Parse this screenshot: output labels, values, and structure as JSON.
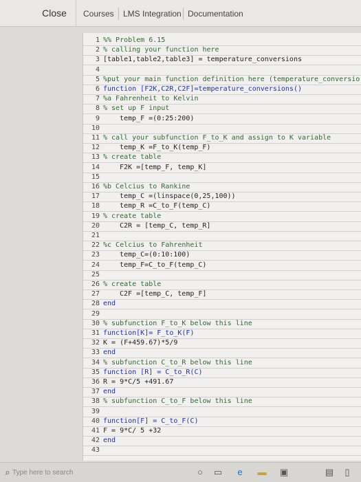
{
  "header": {
    "close_label": "Close",
    "tabs": [
      {
        "label": "Courses"
      },
      {
        "label": "LMS Integration"
      },
      {
        "label": "Documentation"
      }
    ]
  },
  "editor": {
    "lines": [
      {
        "num": "1",
        "text": "%% Problem 6.15",
        "type": "comment",
        "indent": 0
      },
      {
        "num": "2",
        "text": "% calling your function here",
        "type": "comment",
        "indent": 0
      },
      {
        "num": "3",
        "text": "[table1,table2,table3] = temperature_conversions",
        "type": "code",
        "indent": 0
      },
      {
        "num": "4",
        "text": "",
        "type": "code",
        "indent": 0
      },
      {
        "num": "5",
        "text": "%put your main function definition here (temperature_conversio",
        "type": "comment",
        "indent": 0
      },
      {
        "num": "6",
        "text": "function [F2K,C2R,C2F]=temperature_conversions()",
        "type": "keyword",
        "indent": 0
      },
      {
        "num": "7",
        "text": "%a Fahrenheit to Kelvin",
        "type": "comment",
        "indent": 0
      },
      {
        "num": "8",
        "text": "% set up F input",
        "type": "comment",
        "indent": 0
      },
      {
        "num": "9",
        "text": "temp_F =(0:25:200)",
        "type": "code",
        "indent": 3
      },
      {
        "num": "10",
        "text": "",
        "type": "code",
        "indent": 0
      },
      {
        "num": "11",
        "text": "% call your subfunction F_to_K and assign to K variable",
        "type": "comment",
        "indent": 0
      },
      {
        "num": "12",
        "text": "temp_K =F_to_K(temp_F)",
        "type": "code",
        "indent": 3
      },
      {
        "num": "13",
        "text": "% create table",
        "type": "comment",
        "indent": 0
      },
      {
        "num": "14",
        "text": "F2K =[temp_F, temp_K]",
        "type": "code",
        "indent": 3
      },
      {
        "num": "15",
        "text": "",
        "type": "code",
        "indent": 0
      },
      {
        "num": "16",
        "text": "%b Celcius to Rankine",
        "type": "comment",
        "indent": 0
      },
      {
        "num": "17",
        "text": "temp_C =(linspace(0,25,100))",
        "type": "code",
        "indent": 3
      },
      {
        "num": "18",
        "text": "temp_R =C_to_F(temp_C)",
        "type": "code",
        "indent": 3
      },
      {
        "num": "19",
        "text": "% create table",
        "type": "comment",
        "indent": 0
      },
      {
        "num": "20",
        "text": "C2R = [temp_C, temp_R]",
        "type": "code",
        "indent": 3
      },
      {
        "num": "21",
        "text": "",
        "type": "code",
        "indent": 0
      },
      {
        "num": "22",
        "text": "%c Celcius to Fahrenheit",
        "type": "comment",
        "indent": 0
      },
      {
        "num": "23",
        "text": "temp_C=(0:10:100)",
        "type": "code",
        "indent": 3
      },
      {
        "num": "24",
        "text": "temp_F=C_to_F(temp_C)",
        "type": "code",
        "indent": 3
      },
      {
        "num": "25",
        "text": "",
        "type": "code",
        "indent": 0
      },
      {
        "num": "26",
        "text": "% create table",
        "type": "comment",
        "indent": 0
      },
      {
        "num": "27",
        "text": "C2F =[temp_C, temp_F]",
        "type": "code",
        "indent": 3
      },
      {
        "num": "28",
        "text": "end",
        "type": "keyword",
        "indent": 0
      },
      {
        "num": "29",
        "text": "",
        "type": "code",
        "indent": 0
      },
      {
        "num": "30",
        "text": "% subfunction F_to_K below this line",
        "type": "comment",
        "indent": 0
      },
      {
        "num": "31",
        "text": "function[K]= F_to_K(F)",
        "type": "keyword",
        "indent": 0
      },
      {
        "num": "32",
        "text": "K = (F+459.67)*5/9",
        "type": "code",
        "indent": 0
      },
      {
        "num": "33",
        "text": "end",
        "type": "keyword",
        "indent": 0
      },
      {
        "num": "34",
        "text": "% subfunction C_to_R below this line",
        "type": "comment",
        "indent": 0
      },
      {
        "num": "35",
        "text": "function [R] = C_to_R(C)",
        "type": "keyword",
        "indent": 0
      },
      {
        "num": "36",
        "text": "R = 9*C/5 +491.67",
        "type": "code",
        "indent": 0
      },
      {
        "num": "37",
        "text": "end",
        "type": "keyword",
        "indent": 0
      },
      {
        "num": "38",
        "text": "% subfunction C_to_F below this line",
        "type": "comment",
        "indent": 0
      },
      {
        "num": "39",
        "text": "",
        "type": "code",
        "indent": 0
      },
      {
        "num": "40",
        "text": "function[F] = C_to_F(C)",
        "type": "keyword",
        "indent": 0
      },
      {
        "num": "41",
        "text": "F = 9*C/ 5 +32",
        "type": "code",
        "indent": 0
      },
      {
        "num": "42",
        "text": "end",
        "type": "keyword",
        "indent": 0
      },
      {
        "num": "43",
        "text": "",
        "type": "code",
        "indent": 0
      }
    ]
  },
  "taskbar": {
    "search_placeholder": "Type here to search",
    "icons": [
      "search-icon",
      "cortana-icon",
      "task-view-icon",
      "edge-icon",
      "file-explorer-icon",
      "store-icon",
      "network-icon",
      "notifications-icon"
    ]
  }
}
